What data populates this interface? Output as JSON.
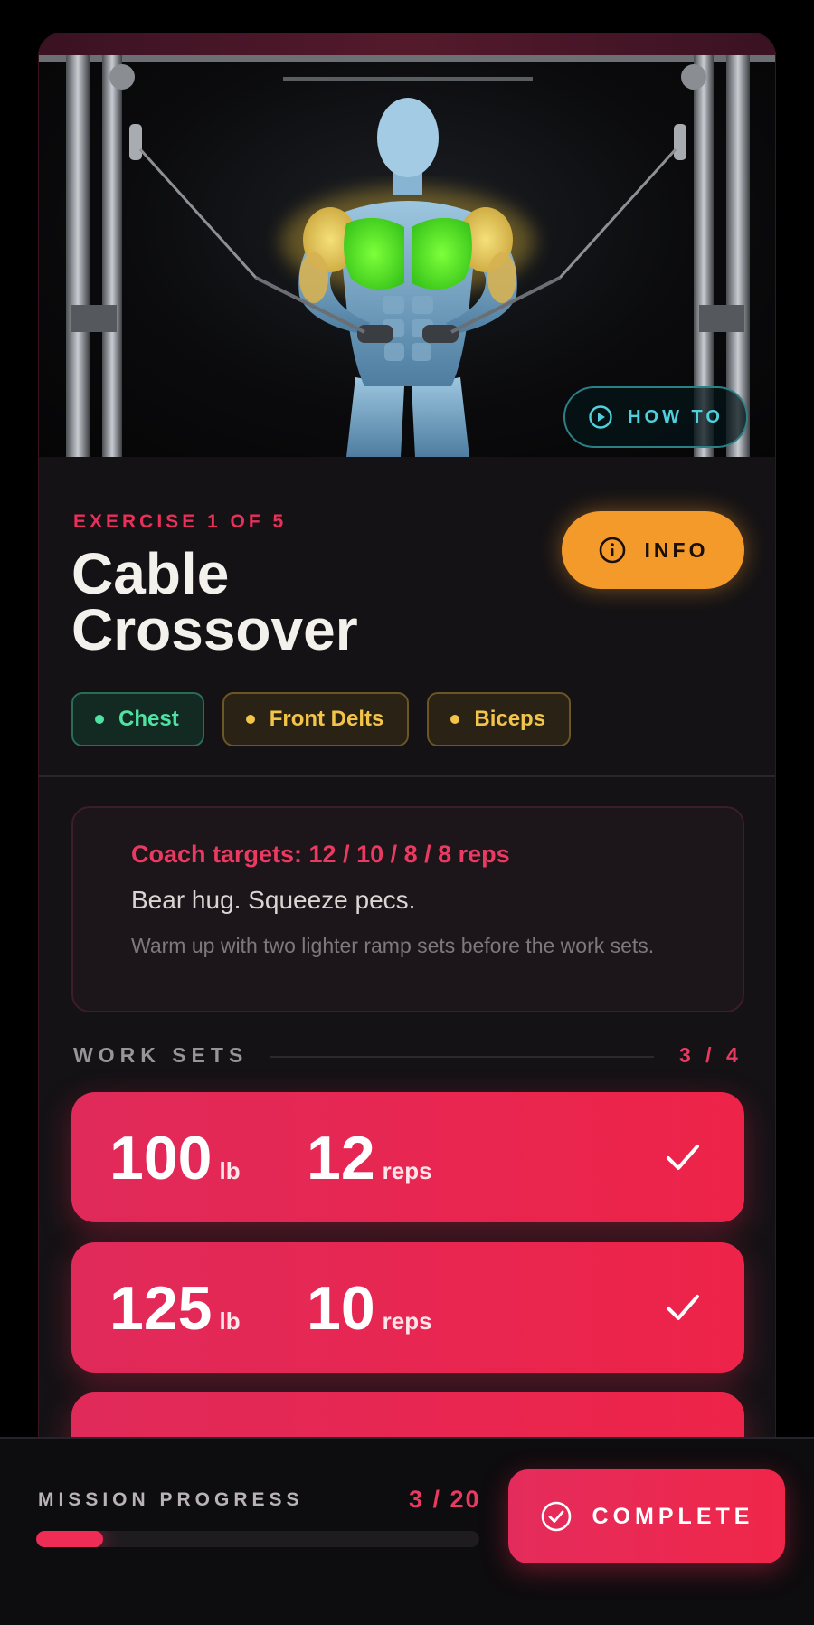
{
  "hero": {
    "howto_label": "HOW TO"
  },
  "exercise": {
    "counter": "EXERCISE 1 OF 5",
    "title_line1": "Cable",
    "title_line2": "Crossover",
    "info_label": "INFO"
  },
  "muscles": [
    {
      "label": "Chest",
      "color": "#4fe3a3"
    },
    {
      "label": "Front Delts",
      "color": "#f2c54a"
    },
    {
      "label": "Biceps",
      "color": "#f2c54a"
    }
  ],
  "coach": {
    "targets": "Coach targets: 12 / 10 / 8 / 8 reps",
    "cue": "Bear hug. Squeeze pecs.",
    "note": "Warm up with two lighter ramp sets before the work sets."
  },
  "work_sets": {
    "label": "WORK SETS",
    "count": "3 / 4",
    "sets": [
      {
        "weight": "100",
        "weight_unit": "lb",
        "reps": "12",
        "reps_unit": "reps",
        "done": true
      },
      {
        "weight": "125",
        "weight_unit": "lb",
        "reps": "10",
        "reps_unit": "reps",
        "done": true
      }
    ]
  },
  "progress": {
    "label": "MISSION PROGRESS",
    "count": "3 / 20",
    "fraction": 0.15
  },
  "actions": {
    "complete_label": "COMPLETE"
  },
  "colors": {
    "accent": "#ee2c55",
    "info": "#f39a2a",
    "howto": "#4fd0dc"
  }
}
